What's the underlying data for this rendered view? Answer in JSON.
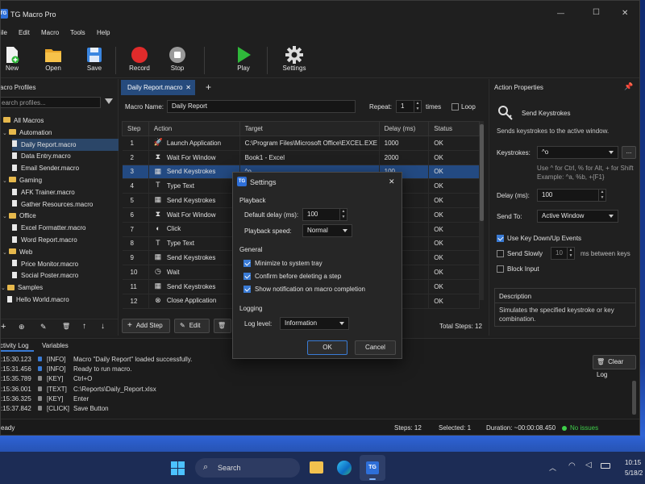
{
  "app": {
    "title": "TG Macro Pro",
    "logo": "TG"
  },
  "window_controls": {
    "minimize": "—",
    "maximize": "☐",
    "close": "✕"
  },
  "menu": [
    "ile",
    "Edit",
    "Macro",
    "Tools",
    "Help"
  ],
  "toolbar": {
    "new": "New",
    "open": "Open",
    "save": "Save",
    "record": "Record",
    "stop": "Stop",
    "play": "Play",
    "settings": "Settings"
  },
  "profiles": {
    "header": "acro Profiles",
    "search_placeholder": "earch profiles...",
    "tree": [
      {
        "label": "All Macros",
        "kind": "folder",
        "level": 0
      },
      {
        "label": "Automation",
        "kind": "folder",
        "level": 1
      },
      {
        "label": "Daily Report.macro",
        "kind": "file",
        "level": 2,
        "selected": true
      },
      {
        "label": "Data Entry.macro",
        "kind": "file",
        "level": 2
      },
      {
        "label": "Email Sender.macro",
        "kind": "file",
        "level": 2
      },
      {
        "label": "Gaming",
        "kind": "folder",
        "level": 1
      },
      {
        "label": "AFK Trainer.macro",
        "kind": "file",
        "level": 2
      },
      {
        "label": "Gather Resources.macro",
        "kind": "file",
        "level": 2
      },
      {
        "label": "Office",
        "kind": "folder",
        "level": 1
      },
      {
        "label": "Excel Formatter.macro",
        "kind": "file",
        "level": 2
      },
      {
        "label": "Word Report.macro",
        "kind": "file",
        "level": 2
      },
      {
        "label": "Web",
        "kind": "folder",
        "level": 1
      },
      {
        "label": "Price Monitor.macro",
        "kind": "file",
        "level": 2
      },
      {
        "label": "Social Poster.macro",
        "kind": "file",
        "level": 2
      },
      {
        "label": "Samples",
        "kind": "folder",
        "level": 0
      },
      {
        "label": "Hello World.macro",
        "kind": "file",
        "level": 1
      }
    ],
    "footer_icons": [
      "+",
      "⊕",
      "✎",
      "🗑",
      "↑",
      "↓"
    ]
  },
  "editor": {
    "tab": "Daily Report.macro",
    "tab_close": "✕",
    "add_tab": "+",
    "name_label": "Macro Name:",
    "name_value": "Daily Report",
    "repeat_label": "Repeat:",
    "repeat_value": "1",
    "times_label": "times",
    "loop_label": "Loop",
    "columns": [
      "Step",
      "Action",
      "Target",
      "Delay (ms)",
      "Status"
    ],
    "rows": [
      {
        "step": "1",
        "icon": "🚀",
        "action": "Launch Application",
        "target": "C:\\Program Files\\Microsoft Office\\EXCEL.EXE",
        "delay": "1000",
        "status": "OK"
      },
      {
        "step": "2",
        "icon": "⧗",
        "action": "Wait For Window",
        "target": "Book1 - Excel",
        "delay": "2000",
        "status": "OK"
      },
      {
        "step": "3",
        "icon": "▦",
        "action": "Send Keystrokes",
        "target": "^o",
        "delay": "100",
        "status": "OK"
      },
      {
        "step": "4",
        "icon": "T",
        "action": "Type Text",
        "target": "",
        "delay": "",
        "status": "OK"
      },
      {
        "step": "5",
        "icon": "▦",
        "action": "Send Keystrokes",
        "target": "",
        "delay": "",
        "status": "OK"
      },
      {
        "step": "6",
        "icon": "⧗",
        "action": "Wait For Window",
        "target": "",
        "delay": "",
        "status": "OK"
      },
      {
        "step": "7",
        "icon": "◐",
        "action": "Click",
        "target": "",
        "delay": "",
        "status": "OK"
      },
      {
        "step": "8",
        "icon": "T",
        "action": "Type Text",
        "target": "",
        "delay": "",
        "status": "OK"
      },
      {
        "step": "9",
        "icon": "▦",
        "action": "Send Keystrokes",
        "target": "",
        "delay": "",
        "status": "OK"
      },
      {
        "step": "10",
        "icon": "◷",
        "action": "Wait",
        "target": "",
        "delay": "",
        "status": "OK"
      },
      {
        "step": "11",
        "icon": "▦",
        "action": "Send Keystrokes",
        "target": "",
        "delay": "",
        "status": "OK"
      },
      {
        "step": "12",
        "icon": "⊗",
        "action": "Close Application",
        "target": "",
        "delay": "",
        "status": "OK"
      }
    ],
    "add_step": "Add Step",
    "edit": "Edit",
    "total_steps": "Total Steps: 12"
  },
  "properties": {
    "header": "Action Properties",
    "action_title": "Send Keystrokes",
    "action_desc": "Sends keystrokes to the active window.",
    "keystrokes_label": "Keystrokes:",
    "keystrokes_value": "^o",
    "browse": "...",
    "hint1": "Use ^ for Ctrl, % for Alt, + for Shift",
    "hint2": "Example: ^a, %b, +{F1}",
    "delay_label": "Delay (ms):",
    "delay_value": "100",
    "sendto_label": "Send To:",
    "sendto_value": "Active Window",
    "use_keydown": "Use Key Down/Up Events",
    "send_slowly": "Send Slowly",
    "slow_value": "10",
    "slow_unit": "ms between keys",
    "block_input": "Block Input",
    "desc_title": "Description",
    "desc_text": "Simulates the specified keystroke or key combination."
  },
  "log": {
    "tabs": [
      "ctivity Log",
      "Variables"
    ],
    "clear": "Clear Log",
    "rows": [
      {
        "time": ":15:30.123",
        "type": "[INFO]",
        "msg": "Macro \"Daily Report\" loaded successfully."
      },
      {
        "time": ":15:31.456",
        "type": "[INFO]",
        "msg": "Ready to run macro."
      },
      {
        "time": ":15:35.789",
        "type": "[KEY]",
        "msg": "Ctrl+O"
      },
      {
        "time": ":15:36.001",
        "type": "[TEXT]",
        "msg": "C:\\Reports\\Daily_Report.xlsx"
      },
      {
        "time": ":15:36.325",
        "type": "[KEY]",
        "msg": "Enter"
      },
      {
        "time": ":15:37.842",
        "type": "[CLICK]",
        "msg": "Save Button"
      }
    ]
  },
  "status": {
    "ready": "eady",
    "steps": "Steps: 12",
    "selected": "Selected: 1",
    "duration": "Duration: ~00:00:08.450",
    "issues": "No issues"
  },
  "dialog": {
    "title": "Settings",
    "close": "✕",
    "playback_header": "Playback",
    "default_delay_label": "Default delay (ms):",
    "default_delay_value": "100",
    "speed_label": "Playback speed:",
    "speed_value": "Normal",
    "general_header": "General",
    "opt1": "Minimize to system tray",
    "opt2": "Confirm before deleting a step",
    "opt3": "Show notification on macro completion",
    "logging_header": "Logging",
    "log_level_label": "Log level:",
    "log_level_value": "Information",
    "ok": "OK",
    "cancel": "Cancel"
  },
  "taskbar": {
    "search": "Search",
    "time": "10:15",
    "date": "5/18/2"
  },
  "colors": {
    "accent": "#3a7bd5",
    "ok": "#3fcf4a",
    "record": "#e02b2b",
    "play": "#2fb83a"
  }
}
